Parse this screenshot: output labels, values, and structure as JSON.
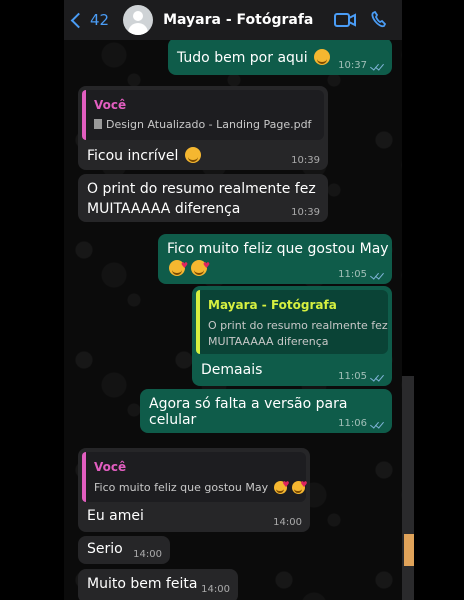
{
  "header": {
    "back_count": "42",
    "contact_name": "Mayara - Fotógrafa",
    "icons": [
      "back-chevron-icon",
      "avatar-icon",
      "video-call-icon",
      "phone-call-icon"
    ]
  },
  "colors": {
    "accent_blue": "#4a9cf5",
    "outgoing_bubble": "#0f5c4a",
    "incoming_bubble": "#262628",
    "quote_you": "#e25ec0",
    "quote_contact": "#d6f040"
  },
  "messages": [
    {
      "direction": "out",
      "text": "Tudo bem por aqui",
      "emoji": "relieved-face",
      "time": "10:37"
    },
    {
      "direction": "in",
      "quote_author": "Você",
      "quote_text": "Design Atualizado - Landing Page.pdf",
      "text": "Ficou incrível",
      "emoji": "star-struck-face",
      "time": "10:39"
    },
    {
      "direction": "in",
      "text_line1": "O print do resumo realmente fez",
      "text_line2": "MUITAAAAA diferença",
      "time": "10:39"
    },
    {
      "direction": "out",
      "text": "Fico muito feliz que gostou May",
      "emoji": "smiling-face-with-hearts",
      "time": "11:05"
    },
    {
      "direction": "out",
      "quote_author": "Mayara - Fotógrafa",
      "quote_line1": "O print do resumo realmente fez",
      "quote_line2": "MUITAAAAA diferença",
      "text": "Demaais",
      "time": "11:05"
    },
    {
      "direction": "out",
      "text": "Agora só falta a versão para celular",
      "time": "11:06"
    },
    {
      "direction": "in",
      "quote_author": "Você",
      "quote_text": "Fico muito feliz que gostou May",
      "text": "Eu amei",
      "time": "14:00"
    },
    {
      "direction": "in",
      "text": "Serio",
      "time": "14:00"
    },
    {
      "direction": "in",
      "text": "Muito bem feita",
      "time": "14:00"
    }
  ]
}
